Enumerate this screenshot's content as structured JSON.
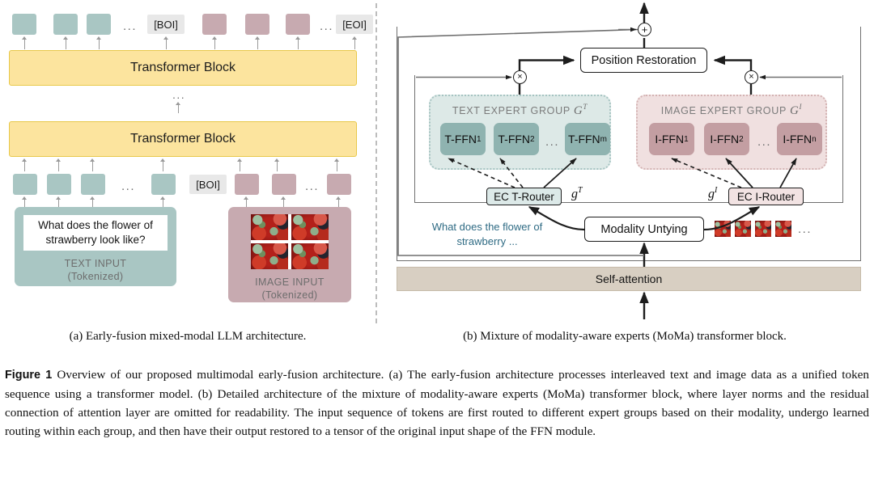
{
  "figure": {
    "label": "Figure 1",
    "caption": "Overview of our proposed multimodal early-fusion architecture. (a) The early-fusion architecture processes interleaved text and image data as a unified token sequence using a transformer model. (b) Detailed architecture of the mixture of modality-aware experts (MoMa) transformer block, where layer norms and the residual connection of attention layer are omitted for readability. The input sequence of tokens are first routed to different expert groups based on their modality, undergo learned routing within each group, and then have their output restored to a tensor of the original input shape of the FFN module.",
    "subcaption_a": "(a) Early-fusion mixed-modal LLM architecture.",
    "subcaption_b": "(b) Mixture of modality-aware experts (MoMa) transformer block."
  },
  "panel_a": {
    "transformer_block_label": "Transformer Block",
    "stack_ellipsis": "...",
    "sequence_ellipsis": "...",
    "tokens_top": [
      {
        "kind": "text"
      },
      {
        "kind": "text"
      },
      {
        "kind": "text"
      },
      {
        "kind": "ellipsis",
        "label": "..."
      },
      {
        "kind": "special",
        "label": "[BOI]"
      },
      {
        "kind": "image"
      },
      {
        "kind": "image"
      },
      {
        "kind": "image"
      },
      {
        "kind": "ellipsis",
        "label": "..."
      },
      {
        "kind": "special",
        "label": "[EOI]"
      }
    ],
    "tokens_bottom": [
      {
        "kind": "text"
      },
      {
        "kind": "text"
      },
      {
        "kind": "text"
      },
      {
        "kind": "ellipsis",
        "label": "..."
      },
      {
        "kind": "text"
      },
      {
        "kind": "special",
        "label": "[BOI]"
      },
      {
        "kind": "image"
      },
      {
        "kind": "image"
      },
      {
        "kind": "ellipsis",
        "label": "..."
      },
      {
        "kind": "image"
      }
    ],
    "text_input": {
      "prompt": "What does the flower of strawberry look like?",
      "caption_line1": "TEXT INPUT",
      "caption_line2": "(Tokenized)"
    },
    "image_input": {
      "caption_line1": "IMAGE INPUT",
      "caption_line2": "(Tokenized)"
    }
  },
  "panel_b": {
    "position_restoration_label": "Position Restoration",
    "modality_untying_label": "Modality Untying",
    "self_attention_label": "Self-attention",
    "add_symbol": "+",
    "multiply_symbol": "×",
    "text_group": {
      "title": "TEXT EXPERT GROUP",
      "symbol": "G",
      "symbol_superscript": "T",
      "experts": [
        {
          "label": "T-FFN",
          "sub": "1"
        },
        {
          "label": "T-FFN",
          "sub": "2"
        },
        {
          "label": "T-FFN",
          "sub": "m"
        }
      ],
      "expert_ellipsis": "...",
      "router_label": "EC T-Router",
      "gate_symbol": "g",
      "gate_superscript": "T"
    },
    "image_group": {
      "title": "IMAGE EXPERT GROUP",
      "symbol": "G",
      "symbol_superscript": "I",
      "experts": [
        {
          "label": "I-FFN",
          "sub": "1"
        },
        {
          "label": "I-FFN",
          "sub": "2"
        },
        {
          "label": "I-FFN",
          "sub": "n"
        }
      ],
      "expert_ellipsis": "...",
      "router_label": "EC I-Router",
      "gate_symbol": "g",
      "gate_superscript": "I"
    },
    "text_preview": "What does the flower of strawberry ...",
    "image_preview_ellipsis": "..."
  },
  "colors": {
    "text_token": "#a9c6c3",
    "image_token": "#c7aab0",
    "transformer_block": "#fce49e",
    "transformer_block_border": "#e8c84a",
    "special_token_bg": "#e8e8e8",
    "text_expert_group_bg": "#dde9e7",
    "image_expert_group_bg": "#f0e0e0",
    "text_ffn": "#8fb3b0",
    "image_ffn": "#c39ea2",
    "self_attention": "#d8cfc2",
    "router_text_bg": "#dce9e8",
    "router_image_bg": "#f2e3e3",
    "preview_text": "#2f6b84",
    "arrow_grey": "#9a9a9a",
    "arrow_black": "#1d1d1d"
  }
}
